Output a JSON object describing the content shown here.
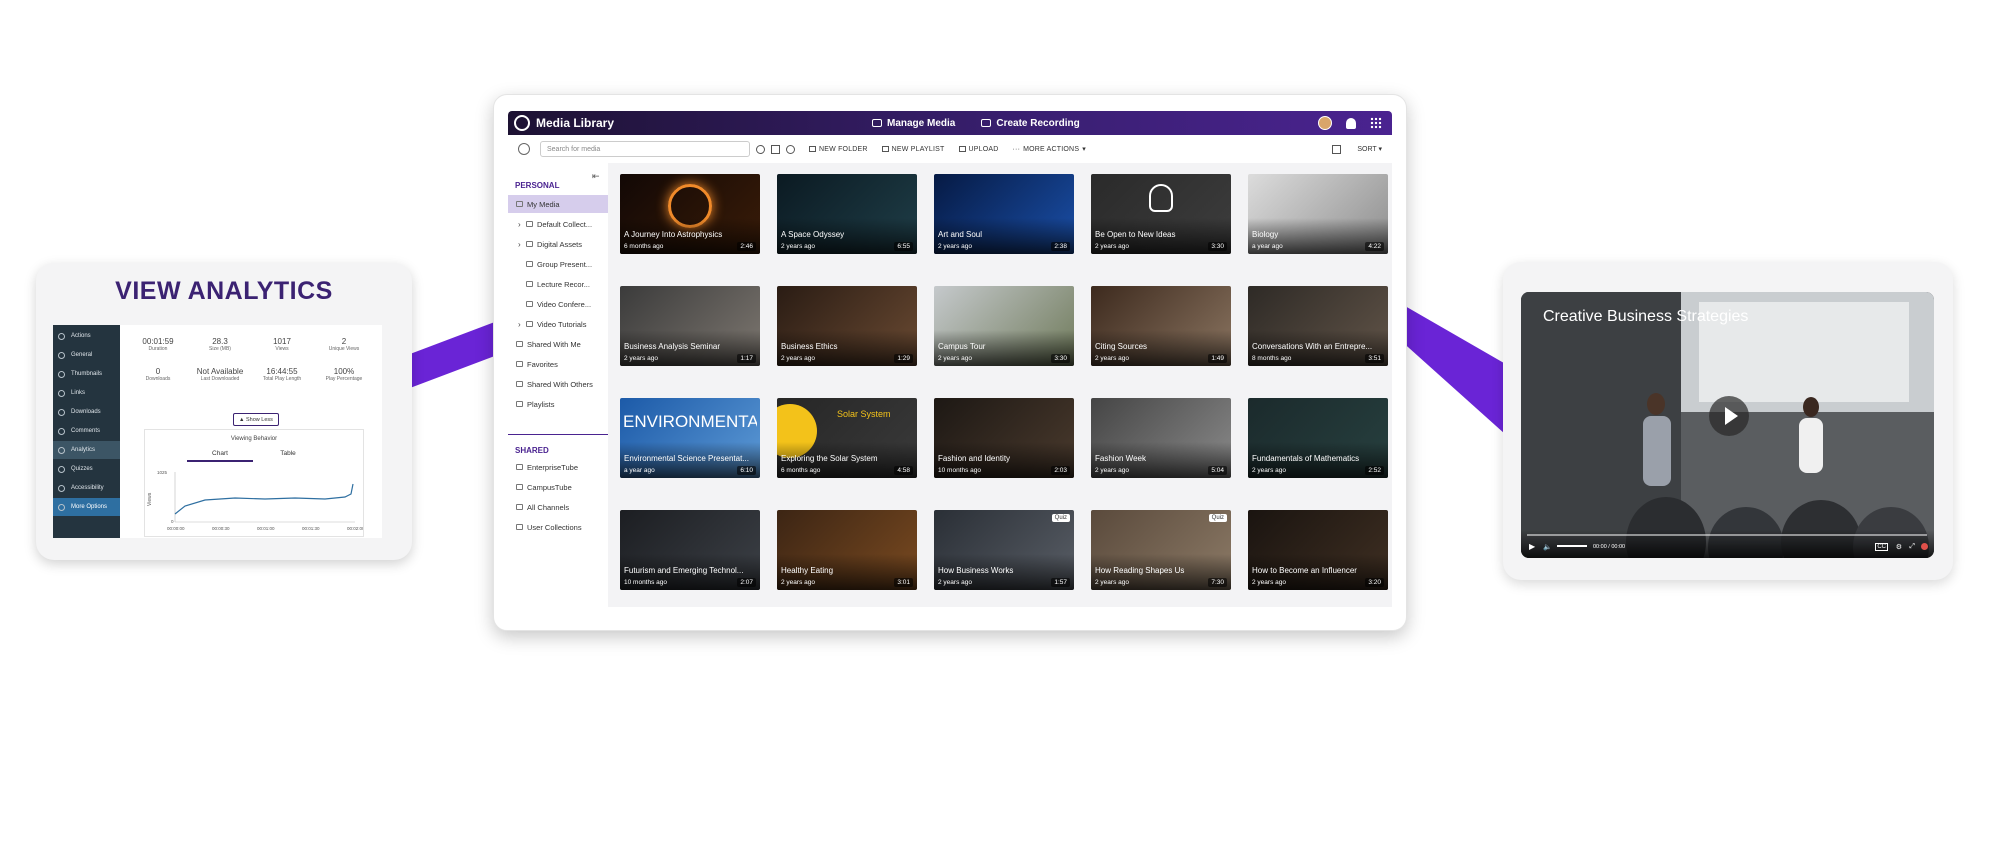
{
  "colors": {
    "accent": "#4a2390",
    "connector": "#6a24d6",
    "analytics_title": "#3b2272"
  },
  "main": {
    "app_title": "Media Library",
    "header_actions": [
      {
        "label": "Manage Media",
        "icon": "media-icon"
      },
      {
        "label": "Create Recording",
        "icon": "recording-icon"
      }
    ],
    "search_placeholder": "Search for media",
    "toolbar": {
      "new_folder": "NEW FOLDER",
      "new_playlist": "NEW PLAYLIST",
      "upload": "UPLOAD",
      "more_actions": "MORE ACTIONS",
      "sort": "SORT"
    },
    "sidebar": {
      "personal_heading": "PERSONAL",
      "personal_items": [
        {
          "label": "My Media",
          "active": true
        },
        {
          "label": "Default Collect...",
          "expandable": true
        },
        {
          "label": "Digital Assets",
          "expandable": true
        },
        {
          "label": "Group Present..."
        },
        {
          "label": "Lecture Recor..."
        },
        {
          "label": "Video Confere..."
        },
        {
          "label": "Video Tutorials",
          "expandable": true
        },
        {
          "label": "Shared With Me"
        },
        {
          "label": "Favorites"
        },
        {
          "label": "Shared With Others"
        },
        {
          "label": "Playlists"
        }
      ],
      "shared_heading": "SHARED",
      "shared_items": [
        {
          "label": "EnterpriseTube"
        },
        {
          "label": "CampusTube"
        },
        {
          "label": "All Channels"
        },
        {
          "label": "User Collections"
        }
      ]
    },
    "media": [
      {
        "title": "A Journey Into Astrophysics",
        "age": "6 months ago",
        "duration": "2:46"
      },
      {
        "title": "A Space Odyssey",
        "age": "2 years ago",
        "duration": "6:55"
      },
      {
        "title": "Art and Soul",
        "age": "2 years ago",
        "duration": "2:38"
      },
      {
        "title": "Be Open to New Ideas",
        "age": "2 years ago",
        "duration": "3:30"
      },
      {
        "title": "Biology",
        "age": "a year ago",
        "duration": "4:22"
      },
      {
        "title": "Business Analysis Seminar",
        "age": "2 years ago",
        "duration": "1:17"
      },
      {
        "title": "Business Ethics",
        "age": "2 years ago",
        "duration": "1:29"
      },
      {
        "title": "Campus Tour",
        "age": "2 years ago",
        "duration": "3:30"
      },
      {
        "title": "Citing Sources",
        "age": "2 years ago",
        "duration": "1:49"
      },
      {
        "title": "Conversations With an Entrepre...",
        "age": "8 months ago",
        "duration": "3:51"
      },
      {
        "title": "Environmental Science Presentat...",
        "age": "a year ago",
        "duration": "6:10",
        "overlay": "ENVIRONMENTAL SCIENCE"
      },
      {
        "title": "Exploring the Solar System",
        "age": "6 months ago",
        "duration": "4:58",
        "overlay": "Solar System"
      },
      {
        "title": "Fashion and Identity",
        "age": "10 months ago",
        "duration": "2:03"
      },
      {
        "title": "Fashion Week",
        "age": "2 years ago",
        "duration": "5:04"
      },
      {
        "title": "Fundamentals of Mathematics",
        "age": "2 years ago",
        "duration": "2:52"
      },
      {
        "title": "Futurism and Emerging Technol...",
        "age": "10 months ago",
        "duration": "2:07"
      },
      {
        "title": "Healthy Eating",
        "age": "2 years ago",
        "duration": "3:01"
      },
      {
        "title": "How Business Works",
        "age": "2 years ago",
        "duration": "1:57",
        "badge": "Quiz"
      },
      {
        "title": "How Reading Shapes Us",
        "age": "2 years ago",
        "duration": "7:30",
        "badge": "Quiz"
      },
      {
        "title": "How to Become an Influencer",
        "age": "2 years ago",
        "duration": "3:20"
      }
    ]
  },
  "analytics": {
    "title": "VIEW ANALYTICS",
    "menu": [
      "Actions",
      "General",
      "Thumbnails",
      "Links",
      "Downloads",
      "Comments",
      "Analytics",
      "Quizzes",
      "Accessibility",
      "More Options"
    ],
    "stats_row1": [
      {
        "value": "00:01:59",
        "label": "Duration"
      },
      {
        "value": "28.3",
        "label": "Size (MB)"
      },
      {
        "value": "1017",
        "label": "Views"
      },
      {
        "value": "2",
        "label": "Unique Views"
      }
    ],
    "stats_row2": [
      {
        "value": "0",
        "label": "Downloads"
      },
      {
        "value": "Not Available",
        "label": "Last Downloaded"
      },
      {
        "value": "16:44:55",
        "label": "Total Play Length"
      },
      {
        "value": "100%",
        "label": "Play Percentage"
      }
    ],
    "show_less": "▲ Show Less",
    "viewing_behavior": "Viewing Behavior",
    "tabs": [
      "Chart",
      "Table"
    ],
    "chart_ylabel": "Views",
    "chart_ytop": "1025",
    "chart_y0": "0",
    "chart_xticks": [
      "00:00:00",
      "00:00:30",
      "00:01:00",
      "00:01:30",
      "00:02:00"
    ]
  },
  "video": {
    "title": "Creative Business Strategies",
    "time": "00:00 / 00:00"
  }
}
